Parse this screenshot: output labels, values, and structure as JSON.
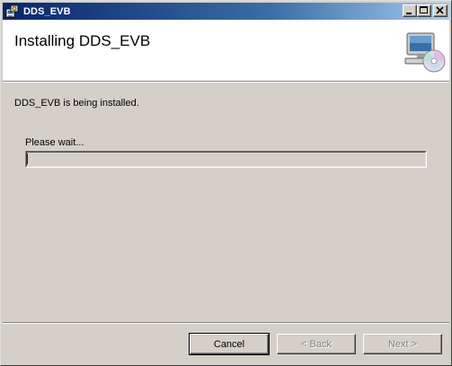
{
  "window": {
    "title": "DDS_EVB"
  },
  "header": {
    "title": "Installing DDS_EVB"
  },
  "body": {
    "status_text": "DDS_EVB is being installed.",
    "wait_label": "Please wait...",
    "progress_fraction": 0.0
  },
  "buttons": {
    "cancel_label": "Cancel",
    "back_label": "< Back",
    "next_label": "Next >"
  },
  "icons": {
    "title_icon": "installer-icon",
    "header_icon": "computer-disc-icon",
    "minimize": "minimize-icon",
    "maximize": "maximize-icon",
    "close": "close-icon"
  },
  "colors": {
    "titlebar_start": "#0a246a",
    "titlebar_end": "#a6caf0",
    "face": "#d4d0c8",
    "header_bg": "#ffffff"
  }
}
